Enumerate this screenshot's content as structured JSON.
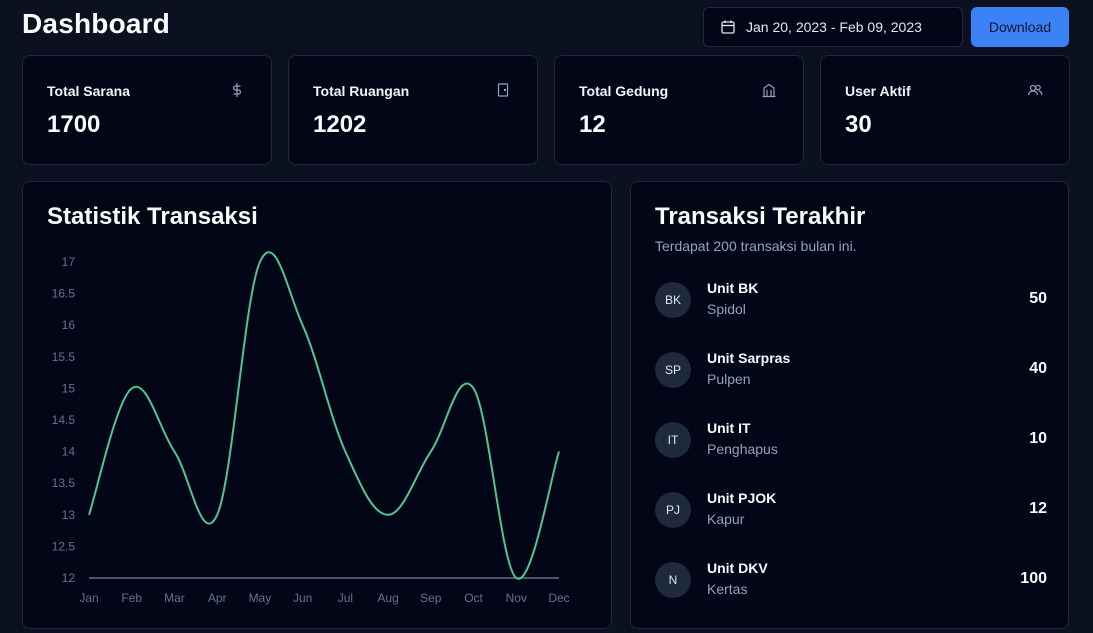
{
  "header": {
    "title": "Dashboard",
    "date_range": "Jan 20, 2023 - Feb 09, 2023",
    "download_label": "Download"
  },
  "stats": [
    {
      "label": "Total Sarana",
      "value": "1700",
      "icon": "dollar-icon"
    },
    {
      "label": "Total Ruangan",
      "value": "1202",
      "icon": "door-icon"
    },
    {
      "label": "Total Gedung",
      "value": "12",
      "icon": "building-icon"
    },
    {
      "label": "User Aktif",
      "value": "30",
      "icon": "users-icon"
    }
  ],
  "statistik": {
    "title": "Statistik Transaksi"
  },
  "chart_data": {
    "type": "line",
    "categories": [
      "Jan",
      "Feb",
      "Mar",
      "Apr",
      "May",
      "Jun",
      "Jul",
      "Aug",
      "Sep",
      "Oct",
      "Nov",
      "Dec"
    ],
    "series": [
      {
        "values": [
          13,
          15,
          14,
          13,
          17,
          16,
          14,
          13,
          14,
          15,
          12,
          14
        ]
      }
    ],
    "ylim": [
      12,
      17
    ],
    "yticks": [
      12,
      12.5,
      13,
      13.5,
      14,
      14.5,
      15,
      15.5,
      16,
      16.5,
      17
    ],
    "line_color": "#4ec78f",
    "grid": false
  },
  "transaksi": {
    "title": "Transaksi Terakhir",
    "subtitle": "Terdapat 200 transaksi bulan ini.",
    "items": [
      {
        "initials": "BK",
        "unit": "Unit BK",
        "item": "Spidol",
        "amount": "50"
      },
      {
        "initials": "SP",
        "unit": "Unit Sarpras",
        "item": "Pulpen",
        "amount": "40"
      },
      {
        "initials": "IT",
        "unit": "Unit IT",
        "item": "Penghapus",
        "amount": "10"
      },
      {
        "initials": "PJ",
        "unit": "Unit PJOK",
        "item": "Kapur",
        "amount": "12"
      },
      {
        "initials": "N",
        "unit": "Unit DKV",
        "item": "Kertas",
        "amount": "100"
      }
    ]
  },
  "colors": {
    "background": "#0b1120",
    "card": "#020617",
    "border": "#1e293b",
    "accent": "#3b82f6",
    "line": "#4ec78f"
  }
}
